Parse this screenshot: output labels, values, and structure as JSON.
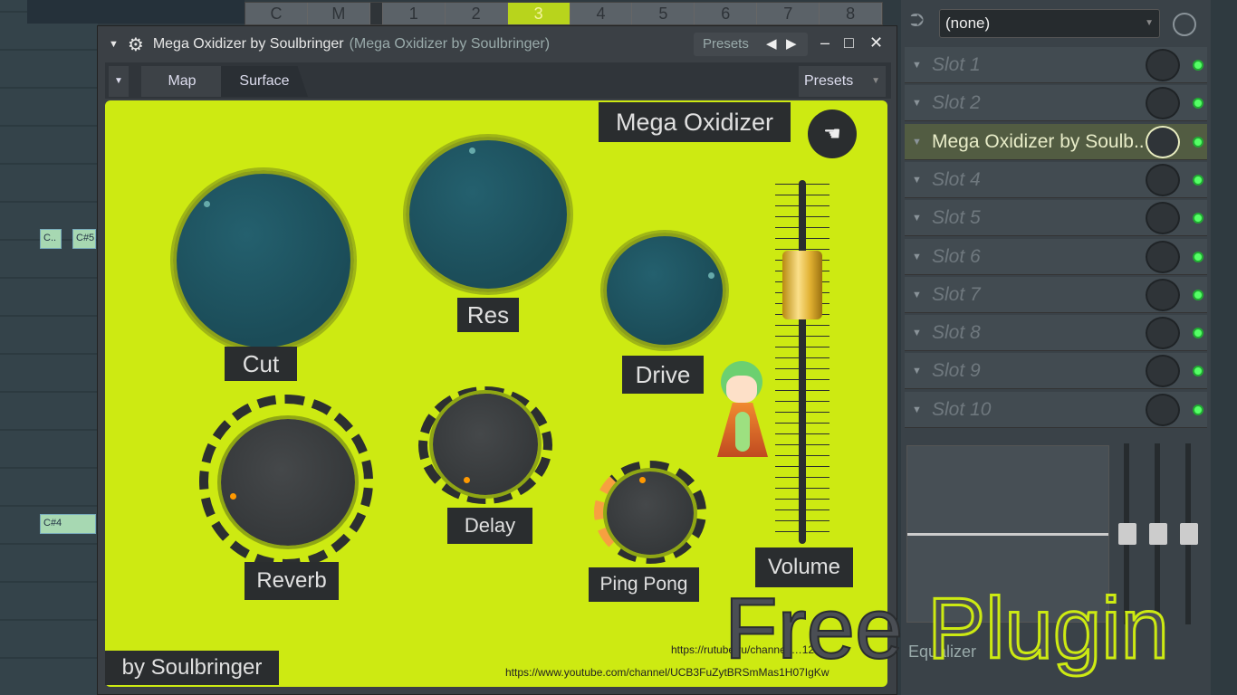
{
  "step_strip": [
    "C",
    "M",
    "1",
    "2",
    "3",
    "4",
    "5",
    "6",
    "7",
    "8"
  ],
  "active_step": "3",
  "notes": [
    "C..",
    "C#5",
    "C#4"
  ],
  "window": {
    "title": "Mega Oxidizer by Soulbringer",
    "subtitle": "(Mega Oxidizer by Soulbringer)",
    "presets": "Presets",
    "minimize": "‒",
    "maximize": "□",
    "close": "✕"
  },
  "tabs": {
    "map": "Map",
    "surface": "Surface",
    "presets": "Presets"
  },
  "surface": {
    "title": "Mega Oxidizer",
    "knobs": {
      "cut": "Cut",
      "res": "Res",
      "drive": "Drive",
      "reverb": "Reverb",
      "delay": "Delay",
      "pingpong": "Ping Pong",
      "volume": "Volume"
    },
    "author": "by Soulbringer",
    "link1": "https://rutube.ru/channel/…12…",
    "link2": "https://www.youtube.com/channel/UCB3FuZytBRSmMas1H07IgKw"
  },
  "mixer": {
    "preset": "(none)",
    "slots": [
      "Slot 1",
      "Slot 2",
      "Mega Oxidizer by Soulb..",
      "Slot 4",
      "Slot 5",
      "Slot 6",
      "Slot 7",
      "Slot 8",
      "Slot 9",
      "Slot 10"
    ],
    "active_slot": 3,
    "eq_label": "Equalizer"
  },
  "overlay": {
    "free": "Free",
    "plugin": "Plugin"
  },
  "colors": {
    "surface": "#cdea12",
    "teal_knob": "#1e4e5a",
    "label_bg": "#2a2d2f"
  }
}
